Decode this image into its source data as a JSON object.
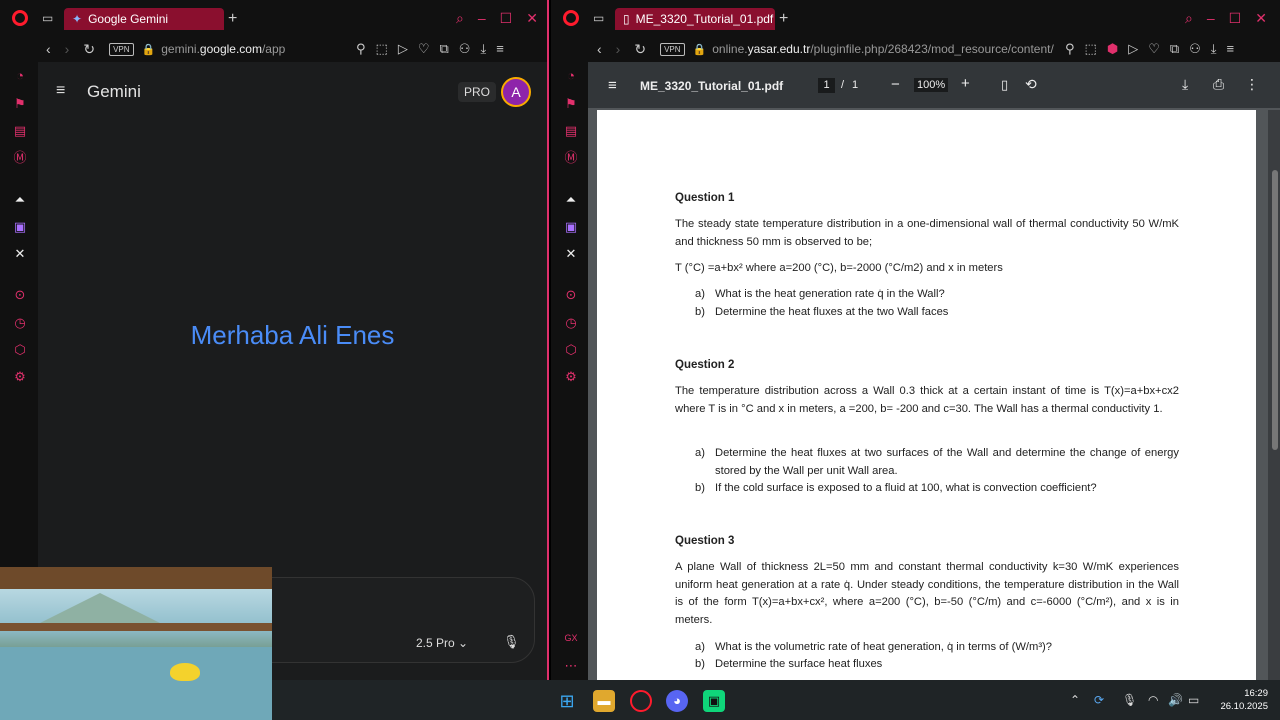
{
  "left_window": {
    "tab_title": "Google Gemini",
    "url_prefix": "gemini.",
    "url_domain": "google.com",
    "url_path": "/app",
    "vpn_label": "VPN"
  },
  "gemini": {
    "app_title": "Gemini",
    "pro_badge": "PRO",
    "avatar_letter": "A",
    "greeting": "Merhaba Ali Enes",
    "model_selector": "2.5 Pro"
  },
  "right_window": {
    "tab_title": "ME_3320_Tutorial_01.pdf",
    "url_prefix": "online.",
    "url_domain": "yasar.edu.tr",
    "url_path": "/pluginfile.php/268423/mod_resource/content/",
    "vpn_label": "VPN"
  },
  "pdf": {
    "file_name": "ME_3320_Tutorial_01.pdf",
    "current_page": "1",
    "separator": "/",
    "total_pages": "1",
    "zoom": "100%",
    "q1": {
      "title": "Question 1",
      "intro": "The steady state temperature distribution in a one-dimensional wall of thermal conductivity 50 W/mK and thickness 50 mm is observed to be;",
      "equation": "T (°C) =a+bx² where a=200 (°C), b=-2000 (°C/m2) and x in meters",
      "items": [
        {
          "marker": "a)",
          "text": "What is the heat generation rate q̇ in the Wall?"
        },
        {
          "marker": "b)",
          "text": "Determine the heat fluxes at the two Wall faces"
        }
      ]
    },
    "q2": {
      "title": "Question 2",
      "intro": "The temperature distribution across a Wall 0.3 thick at a certain instant of time is T(x)=a+bx+cx2 where T is in °C and x in meters, a =200, b= -200 and c=30. The Wall has a thermal conductivity 1.",
      "items": [
        {
          "marker": "a)",
          "text": "Determine the heat fluxes at two surfaces of the Wall and determine the change of energy stored by the Wall per unit Wall area."
        },
        {
          "marker": "b)",
          "text": "If the cold surface is exposed to a fluid at 100, what is convection coefficient?"
        }
      ]
    },
    "q3": {
      "title": "Question 3",
      "intro": "A plane Wall of thickness 2L=50 mm and constant thermal conductivity k=30 W/mK experiences uniform heat generation at a rate q̇. Under steady conditions, the temperature distribution in the Wall is of the form T(x)=a+bx+cx², where a=200 (°C), b=-50 (°C/m) and c=-6000 (°C/m²), and x is in meters.",
      "items": [
        {
          "marker": "a)",
          "text": "What is the volumetric rate of heat generation, q̇ in terms of (W/m³)?"
        },
        {
          "marker": "b)",
          "text": "Determine the surface heat fluxes"
        }
      ]
    }
  },
  "taskbar": {
    "time": "16:29",
    "date": "26.10.2025"
  },
  "colors": {
    "opera_red": "#ff1b2d",
    "sidebar_accent": "#e1306c",
    "gemini_greeting": "#4a8cf7",
    "tab_active": "#8a0f2e"
  }
}
